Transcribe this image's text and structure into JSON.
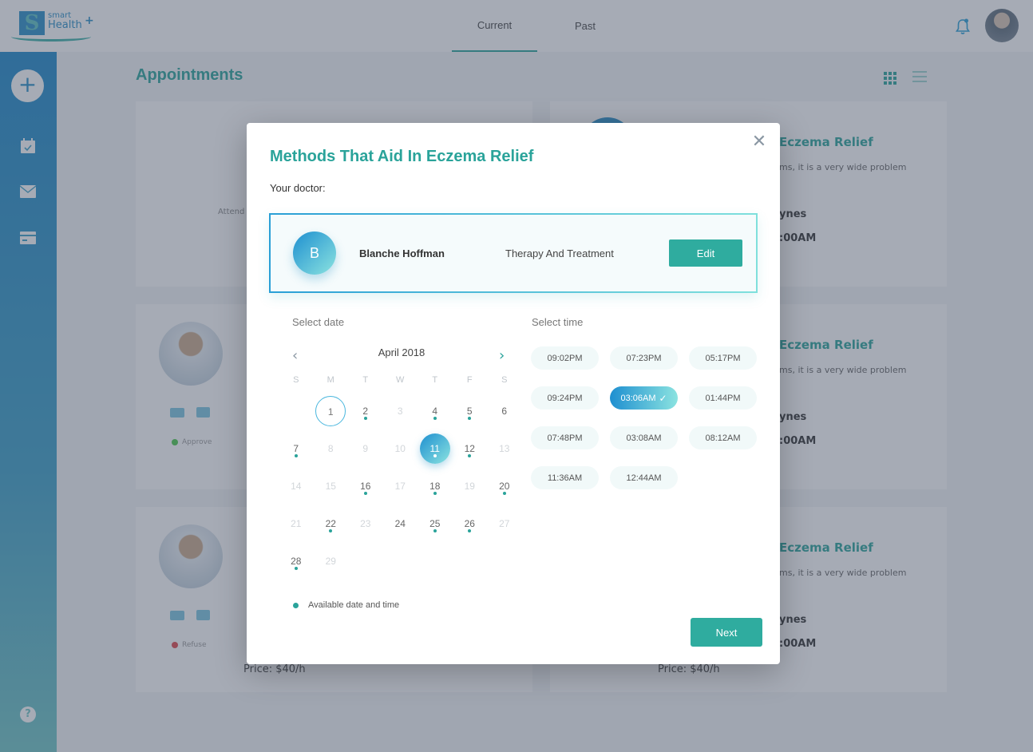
{
  "app": {
    "logo_small": "smart",
    "logo_main": "Health",
    "logo_plus": "+",
    "logo_mark": "S"
  },
  "header": {
    "tabs": [
      {
        "label": "Current",
        "active": true
      },
      {
        "label": "Past",
        "active": false
      }
    ]
  },
  "page": {
    "title": "Appointments"
  },
  "sidebar": {
    "items": [
      {
        "icon": "plus-icon"
      },
      {
        "icon": "calendar-check-icon"
      },
      {
        "icon": "mail-icon"
      },
      {
        "icon": "credit-card-icon"
      },
      {
        "icon": "help-icon"
      }
    ],
    "help_glyph": "?"
  },
  "background_cards": [
    {
      "partial_text": "Attend"
    },
    {
      "title_fragment": "Eczema Relief",
      "desc_fragment": "ms, it is a very wide problem",
      "doctor_fragment": "ynes",
      "time_fragment": ":00AM"
    },
    {
      "status": "Approve",
      "status_color": "#4cc94c"
    },
    {
      "title_fragment": "Eczema Relief",
      "desc_fragment": "ms, it is a very wide problem",
      "doctor_fragment": "ynes",
      "time_fragment": ":00AM"
    },
    {
      "status": "Refuse",
      "status_color": "#e0474c",
      "price": "Price: $40/h"
    },
    {
      "title_fragment": "Eczema Relief",
      "desc_fragment": "ms, it is a very wide problem",
      "doctor_fragment": "ynes",
      "time_fragment": ":00AM",
      "price": "Price: $40/h"
    }
  ],
  "modal": {
    "title": "Methods That Aid In Eczema Relief",
    "close_glyph": "✕",
    "doctor_label": "Your doctor:",
    "doctor": {
      "initial": "B",
      "name": "Blanche Hoffman",
      "specialty": "Therapy And Treatment",
      "edit_label": "Edit"
    },
    "date_section_label": "Select date",
    "time_section_label": "Select time",
    "calendar": {
      "month_label": "April 2018",
      "prev_glyph": "‹",
      "next_glyph": "›",
      "weekdays": [
        "S",
        "M",
        "T",
        "W",
        "T",
        "F",
        "S"
      ],
      "leading_blanks": 1,
      "today": 1,
      "selected": 11,
      "days": [
        {
          "d": "1",
          "avail": false
        },
        {
          "d": "2",
          "avail": true
        },
        {
          "d": "3",
          "avail": false
        },
        {
          "d": "4",
          "avail": true
        },
        {
          "d": "5",
          "avail": true
        },
        {
          "d": "6",
          "avail": false,
          "strong": true
        },
        {
          "d": "7",
          "avail": true
        },
        {
          "d": "8",
          "avail": false
        },
        {
          "d": "9",
          "avail": false
        },
        {
          "d": "10",
          "avail": false
        },
        {
          "d": "11",
          "avail": true
        },
        {
          "d": "12",
          "avail": true
        },
        {
          "d": "13",
          "avail": false
        },
        {
          "d": "14",
          "avail": false
        },
        {
          "d": "15",
          "avail": false
        },
        {
          "d": "16",
          "avail": true
        },
        {
          "d": "17",
          "avail": false
        },
        {
          "d": "18",
          "avail": true
        },
        {
          "d": "19",
          "avail": false
        },
        {
          "d": "20",
          "avail": true
        },
        {
          "d": "21",
          "avail": false
        },
        {
          "d": "22",
          "avail": true
        },
        {
          "d": "23",
          "avail": false
        },
        {
          "d": "24",
          "avail": false,
          "strong": true
        },
        {
          "d": "25",
          "avail": true
        },
        {
          "d": "26",
          "avail": true
        },
        {
          "d": "27",
          "avail": false
        },
        {
          "d": "28",
          "avail": true
        },
        {
          "d": "29",
          "avail": false
        }
      ]
    },
    "legend_label": "Available date and time",
    "times": [
      {
        "label": "09:02PM",
        "selected": false
      },
      {
        "label": "07:23PM",
        "selected": false
      },
      {
        "label": "05:17PM",
        "selected": false
      },
      {
        "label": "09:24PM",
        "selected": false
      },
      {
        "label": "03:06AM",
        "selected": true
      },
      {
        "label": "01:44PM",
        "selected": false
      },
      {
        "label": "07:48PM",
        "selected": false
      },
      {
        "label": "03:08AM",
        "selected": false
      },
      {
        "label": "08:12AM",
        "selected": false
      },
      {
        "label": "11:36AM",
        "selected": false
      },
      {
        "label": "12:44AM",
        "selected": false
      }
    ],
    "check_glyph": "✓",
    "next_label": "Next"
  },
  "colors": {
    "accent": "#2aa39a",
    "brand_blue": "#1e8fd0",
    "available_dot": "#2aa39a"
  }
}
